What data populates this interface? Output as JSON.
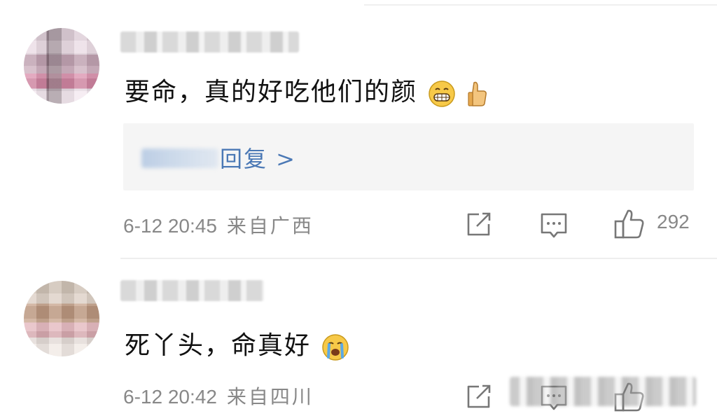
{
  "comments": [
    {
      "text": "要命，真的好吃他们的颜",
      "emojis": [
        "grinning-face-emoji",
        "thumbs-up-emoji"
      ],
      "replies_label": "回复 >",
      "timestamp": "6-12 20:45",
      "location": "来自广西",
      "like_count": "292"
    },
    {
      "text": "死丫头，命真好",
      "emojis": [
        "crying-face-emoji"
      ],
      "timestamp": "6-12 20:42",
      "location": "来自四川"
    }
  ],
  "colors": {
    "text": "#111111",
    "meta": "#888888",
    "link": "#4a78b5",
    "reply_box_bg": "#f5f5f5"
  }
}
